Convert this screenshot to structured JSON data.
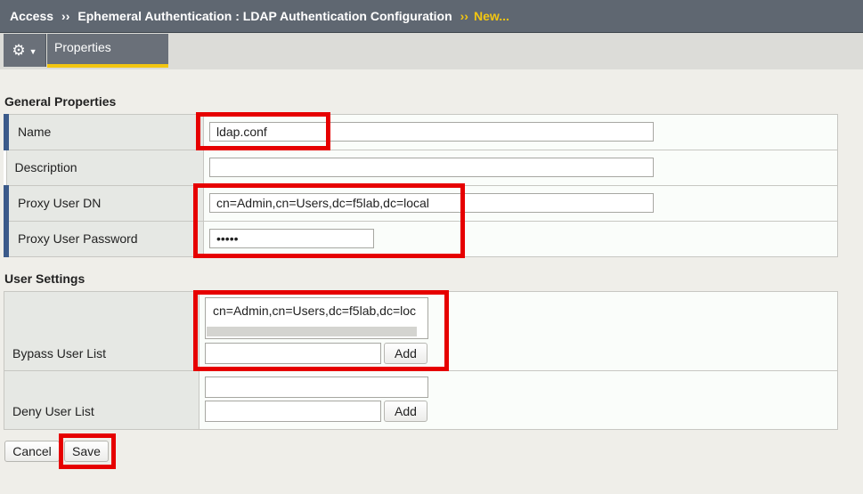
{
  "breadcrumb": {
    "root": "Access",
    "separator": "››",
    "path": "Ephemeral Authentication : LDAP Authentication Configuration",
    "current": "New..."
  },
  "tabs": {
    "gear_icon": "gear-icon",
    "active_tab": "Properties"
  },
  "general_properties": {
    "title": "General Properties",
    "name_label": "Name",
    "name_value": "ldap.conf",
    "description_label": "Description",
    "description_value": "",
    "proxy_dn_label": "Proxy User DN",
    "proxy_dn_value": "cn=Admin,cn=Users,dc=f5lab,dc=local",
    "proxy_password_label": "Proxy User Password",
    "proxy_password_value": "•••••"
  },
  "user_settings": {
    "title": "User Settings",
    "bypass_label": "Bypass User List",
    "bypass_list_items": [
      "cn=Admin,cn=Users,dc=f5lab,dc=loc"
    ],
    "bypass_input_value": "",
    "bypass_add_label": "Add",
    "deny_label": "Deny User List",
    "deny_list_items": [],
    "deny_input_value": "",
    "deny_add_label": "Add"
  },
  "actions": {
    "cancel_label": "Cancel",
    "save_label": "Save"
  },
  "colors": {
    "titlebar": "#5f6771",
    "accent": "#f3c611",
    "highlight": "#e60000",
    "required_marker": "#3b5a8a"
  }
}
